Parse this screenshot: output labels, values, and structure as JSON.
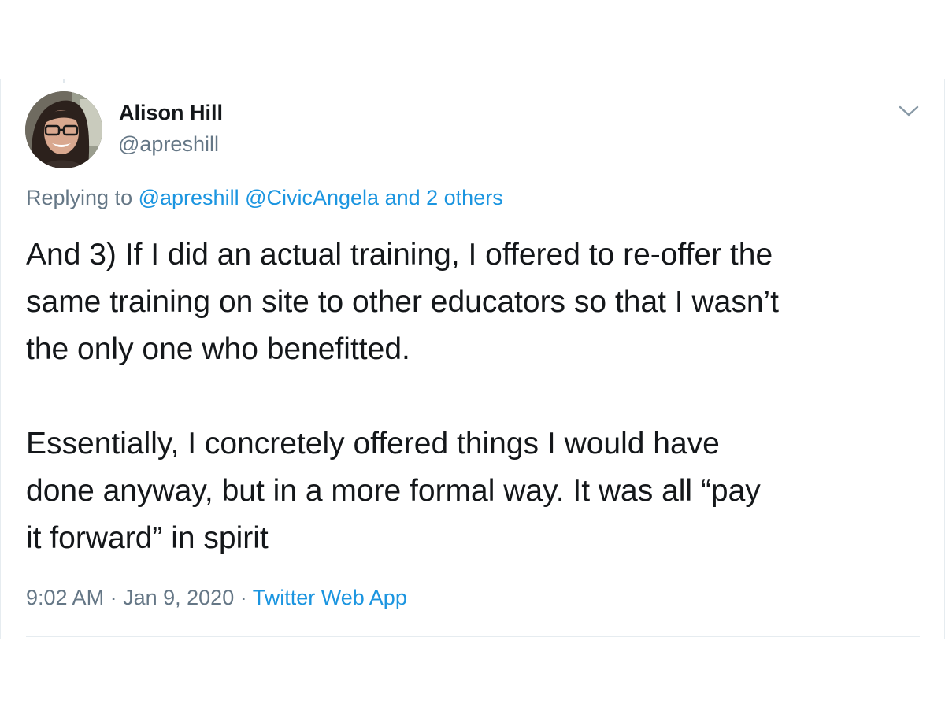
{
  "tweet": {
    "author": {
      "name": "Alison Hill",
      "handle": "@apreshill"
    },
    "reply": {
      "prefix": "Replying to",
      "mentions": [
        "@apreshill",
        "@CivicAngela",
        "and 2 others"
      ]
    },
    "body": {
      "paragraph1": [
        "And 3) If I did an actual training, I offered to re-offer the",
        "same training on site to other educators so that I wasn’t",
        "the only one who benefitted."
      ],
      "paragraph2": [
        "Essentially, I concretely offered things I would have",
        "done anyway, but in a more formal way. It was all “pay",
        "it forward” in spirit"
      ]
    },
    "meta": {
      "time": "9:02 AM",
      "separator": "·",
      "date": "Jan 9, 2020",
      "source": "Twitter Web App"
    },
    "icons": {
      "menu": "chevron-down-icon",
      "avatar": "profile-photo"
    },
    "colors": {
      "text": "#14171a",
      "secondary": "#657786",
      "link": "#1b95e0",
      "border": "#e6ecf0"
    }
  }
}
